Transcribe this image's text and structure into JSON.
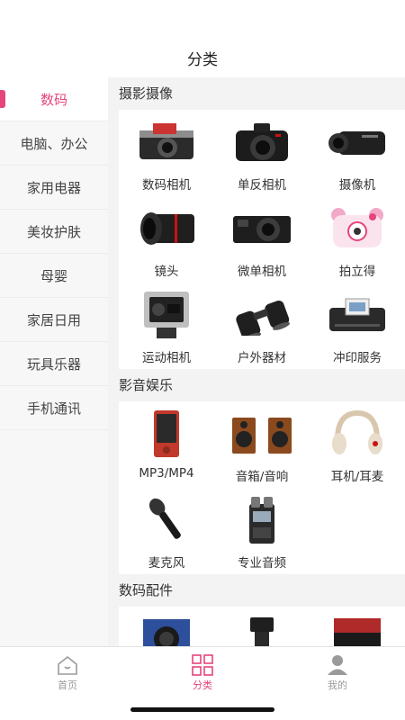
{
  "header": {
    "title": "分类"
  },
  "sidebar": {
    "items": [
      {
        "label": "数码"
      },
      {
        "label": "电脑、办公"
      },
      {
        "label": "家用电器"
      },
      {
        "label": "美妆护肤"
      },
      {
        "label": "母婴"
      },
      {
        "label": "家居日用"
      },
      {
        "label": "玩具乐器"
      },
      {
        "label": "手机通讯"
      }
    ]
  },
  "sections": [
    {
      "title": "摄影摄像",
      "items": [
        {
          "label": "数码相机",
          "icon": "digital-camera-icon"
        },
        {
          "label": "单反相机",
          "icon": "dslr-camera-icon"
        },
        {
          "label": "摄像机",
          "icon": "camcorder-icon"
        },
        {
          "label": "镜头",
          "icon": "lens-icon"
        },
        {
          "label": "微单相机",
          "icon": "mirrorless-camera-icon"
        },
        {
          "label": "拍立得",
          "icon": "instant-camera-icon"
        },
        {
          "label": "运动相机",
          "icon": "action-camera-icon"
        },
        {
          "label": "户外器材",
          "icon": "binoculars-icon"
        },
        {
          "label": "冲印服务",
          "icon": "photo-printer-icon"
        }
      ]
    },
    {
      "title": "影音娱乐",
      "items": [
        {
          "label": "MP3/MP4",
          "icon": "mp3-player-icon"
        },
        {
          "label": "音箱/音响",
          "icon": "speakers-icon"
        },
        {
          "label": "耳机/耳麦",
          "icon": "headphones-icon"
        },
        {
          "label": "麦克风",
          "icon": "microphone-icon"
        },
        {
          "label": "专业音频",
          "icon": "audio-recorder-icon"
        }
      ]
    },
    {
      "title": "数码配件",
      "items": [
        {
          "label": "",
          "icon": "accessory-box-icon"
        },
        {
          "label": "",
          "icon": "flash-icon"
        },
        {
          "label": "",
          "icon": "memory-card-icon"
        }
      ]
    }
  ],
  "tabbar": {
    "tabs": [
      {
        "label": "首页",
        "icon": "home-icon"
      },
      {
        "label": "分类",
        "icon": "category-grid-icon"
      },
      {
        "label": "我的",
        "icon": "user-icon"
      }
    ]
  },
  "colors": {
    "accent": "#e6457a",
    "sidebar_bg": "#f7f7f7",
    "content_bg": "#f3f3f3"
  }
}
